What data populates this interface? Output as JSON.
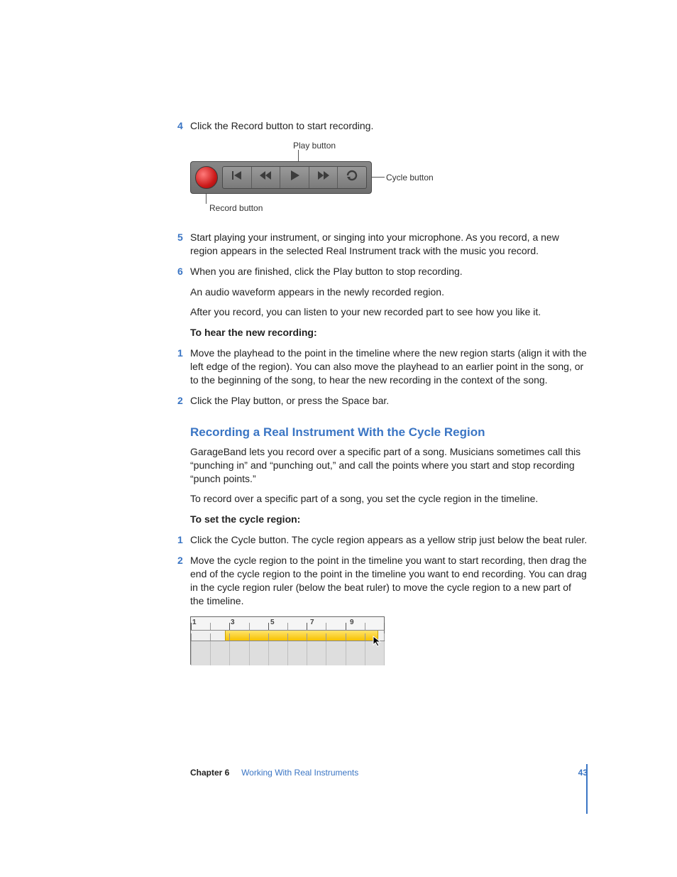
{
  "steps_a": [
    {
      "n": "4",
      "text": "Click the Record button to start recording."
    },
    {
      "n": "5",
      "text": "Start playing your instrument, or singing into your microphone. As you record, a new region appears in the selected Real Instrument track with the music you record."
    },
    {
      "n": "6",
      "text": "When you are finished, click the Play button to stop recording."
    }
  ],
  "after6_a": "An audio waveform appears in the newly recorded region.",
  "after6_b": "After you record, you can listen to your new recorded part to see how you like it.",
  "hear_heading": "To hear the new recording:",
  "hear_steps": [
    {
      "n": "1",
      "text": "Move the playhead to the point in the timeline where the new region starts (align it with the left edge of the region). You can also move the playhead to an earlier point in the song, or to the beginning of the song, to hear the new recording in the context of the song."
    },
    {
      "n": "2",
      "text": "Click the Play button, or press the Space bar."
    }
  ],
  "section_heading": "Recording a Real Instrument With the Cycle Region",
  "section_para_a": "GarageBand lets you record over a specific part of a song. Musicians sometimes call this “punching in” and “punching out,” and call the points where you start and stop recording “punch points.”",
  "section_para_b": "To record over a specific part of a song, you set the cycle region in the timeline.",
  "cycle_heading": "To set the cycle region:",
  "cycle_steps": [
    {
      "n": "1",
      "text": "Click the Cycle button. The cycle region appears as a yellow strip just below the beat ruler."
    },
    {
      "n": "2",
      "text": "Move the cycle region to the point in the timeline you want to start recording, then drag the end of the cycle region to the point in the timeline you want to end recording. You can drag in the cycle region ruler (below the beat ruler) to move the cycle region to a new part of the timeline."
    }
  ],
  "callouts": {
    "play": "Play button",
    "cycle": "Cycle button",
    "record": "Record button"
  },
  "ruler_labels": [
    "1",
    "3",
    "5",
    "7",
    "9"
  ],
  "footer": {
    "chapter_label": "Chapter 6",
    "chapter_title": "Working With Real Instruments",
    "page": "43"
  }
}
